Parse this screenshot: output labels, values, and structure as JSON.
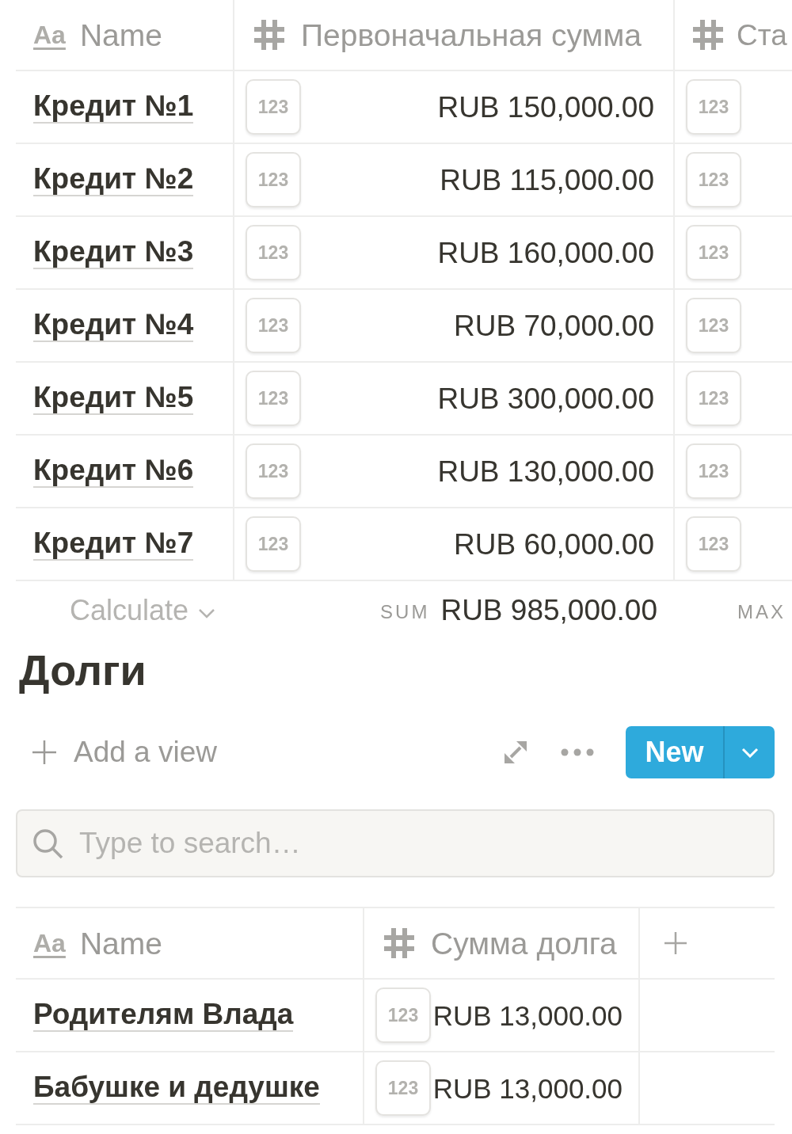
{
  "loans_table": {
    "columns": [
      {
        "kind": "title",
        "type_glyph": "Aa",
        "label": "Name"
      },
      {
        "kind": "number",
        "label": "Первоначальная сумма"
      },
      {
        "kind": "number",
        "label": "Ста"
      }
    ],
    "rows": [
      {
        "name": "Кредит №1",
        "amount_format": "123",
        "amount": "RUB 150,000.00",
        "column_3_format": "123"
      },
      {
        "name": "Кредит №2",
        "amount_format": "123",
        "amount": "RUB 115,000.00",
        "column_3_format": "123"
      },
      {
        "name": "Кредит №3",
        "amount_format": "123",
        "amount": "RUB 160,000.00",
        "column_3_format": "123"
      },
      {
        "name": "Кредит №4",
        "amount_format": "123",
        "amount": "RUB 70,000.00",
        "column_3_format": "123"
      },
      {
        "name": "Кредит №5",
        "amount_format": "123",
        "amount": "RUB 300,000.00",
        "column_3_format": "123"
      },
      {
        "name": "Кредит №6",
        "amount_format": "123",
        "amount": "RUB 130,000.00",
        "column_3_format": "123"
      },
      {
        "name": "Кредит №7",
        "amount_format": "123",
        "amount": "RUB 60,000.00",
        "column_3_format": "123"
      }
    ],
    "footer": {
      "calculate": "Calculate",
      "column_2_function": "SUM",
      "column_2_value": "RUB 985,000.00",
      "column_3_function": "MAX"
    }
  },
  "debts": {
    "title": "Долги",
    "add_view": "Add a view",
    "new_button": "New",
    "search": {
      "placeholder": "Type to search…"
    },
    "table": {
      "columns": [
        {
          "kind": "title",
          "type_glyph": "Aa",
          "label": "Name"
        },
        {
          "kind": "number",
          "label": "Сумма долга"
        },
        {
          "kind": "add"
        }
      ],
      "rows": [
        {
          "name": "Родителям Влада",
          "amount_format": "123",
          "amount": "RUB 13,000.00"
        },
        {
          "name": "Бабушке и дедушке",
          "amount_format": "123",
          "amount": "RUB 13,000.00"
        }
      ]
    }
  }
}
